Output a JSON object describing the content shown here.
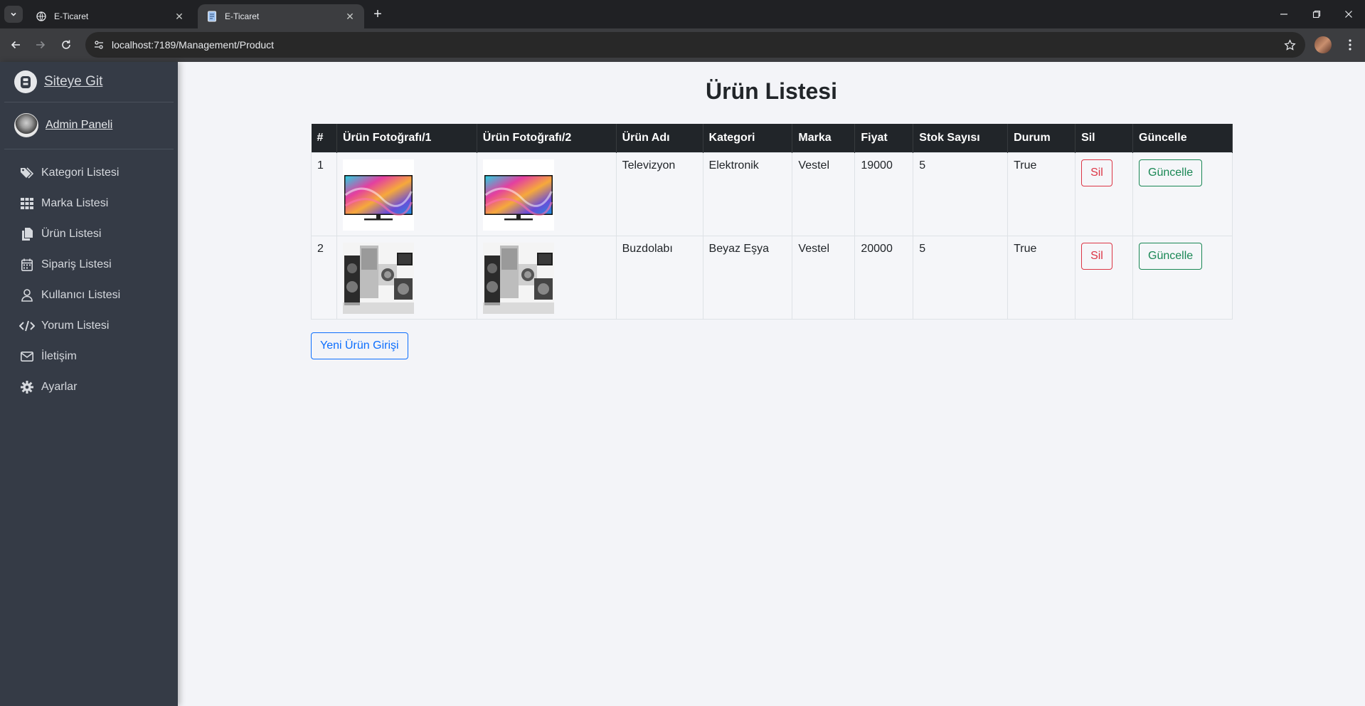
{
  "browser": {
    "tabs": [
      {
        "title": "E-Ticaret",
        "active": false
      },
      {
        "title": "E-Ticaret",
        "active": true
      }
    ],
    "url": "localhost:7189/Management/Product"
  },
  "sidebar": {
    "brand": "Siteye Git",
    "user": "Admin Paneli",
    "items": [
      {
        "label": "Kategori Listesi",
        "icon": "tags-icon"
      },
      {
        "label": "Marka Listesi",
        "icon": "grid-icon"
      },
      {
        "label": "Ürün Listesi",
        "icon": "copy-icon"
      },
      {
        "label": "Sipariş Listesi",
        "icon": "calendar-icon"
      },
      {
        "label": "Kullanıcı Listesi",
        "icon": "user-icon"
      },
      {
        "label": "Yorum Listesi",
        "icon": "code-icon"
      },
      {
        "label": "İletişim",
        "icon": "envelope-icon"
      },
      {
        "label": "Ayarlar",
        "icon": "gear-icon"
      }
    ]
  },
  "main": {
    "title": "Ürün Listesi",
    "table": {
      "headers": [
        "#",
        "Ürün Fotoğrafı/1",
        "Ürün Fotoğrafı/2",
        "Ürün Adı",
        "Kategori",
        "Marka",
        "Fiyat",
        "Stok Sayısı",
        "Durum",
        "Sil",
        "Güncelle"
      ],
      "rows": [
        {
          "id": "1",
          "name": "Televizyon",
          "category": "Elektronik",
          "brand": "Vestel",
          "price": "19000",
          "stock": "5",
          "status": "True",
          "image": "tv-photo",
          "delete": "Sil",
          "update": "Güncelle"
        },
        {
          "id": "2",
          "name": "Buzdolabı",
          "category": "Beyaz Eşya",
          "brand": "Vestel",
          "price": "20000",
          "stock": "5",
          "status": "True",
          "image": "appliances-photo",
          "delete": "Sil",
          "update": "Güncelle"
        }
      ]
    },
    "new_button": "Yeni Ürün Girişi"
  },
  "colors": {
    "sidebar_bg": "#353b46",
    "table_header_bg": "#212529",
    "danger": "#dc3545",
    "success": "#198754",
    "primary": "#0d6efd"
  }
}
